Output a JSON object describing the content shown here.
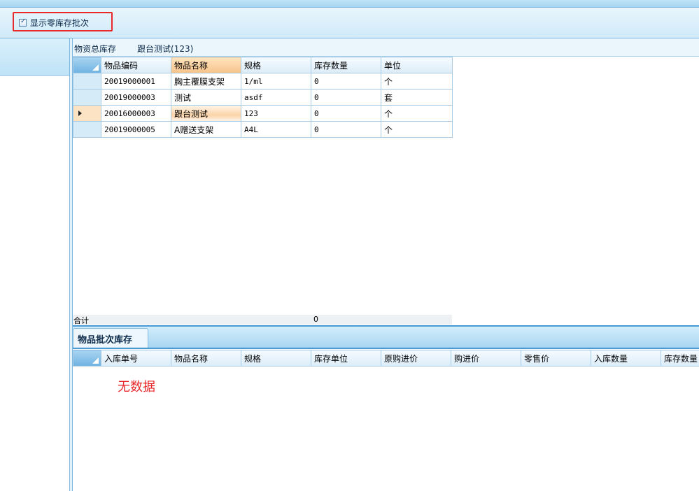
{
  "toolbar": {
    "show_zero_stock_batches": {
      "label": "显示零库存批次",
      "checked": true
    }
  },
  "info_bar": {
    "left_text": "物资总库存",
    "right_text": "跟台测试(123)"
  },
  "inventory_grid": {
    "columns": [
      "物品编码",
      "物品名称",
      "规格",
      "库存数量",
      "单位"
    ],
    "rows": [
      {
        "code": "20019000001",
        "name": "胸主覆膜支架",
        "spec": "1/ml",
        "qty": "0",
        "unit": "个"
      },
      {
        "code": "20019000003",
        "name": "测试",
        "spec": "asdf",
        "qty": "0",
        "unit": "套"
      },
      {
        "code": "20016000003",
        "name": "跟台测试",
        "spec": "123",
        "qty": "0",
        "unit": "个"
      },
      {
        "code": "20019000005",
        "name": "A赠送支架",
        "spec": "A4L",
        "qty": "0",
        "unit": "个"
      }
    ],
    "total_label": "合计",
    "total_qty": "0"
  },
  "batch_tab": {
    "label": "物品批次库存"
  },
  "batch_grid": {
    "columns": [
      "入库单号",
      "物品名称",
      "规格",
      "库存单位",
      "原购进价",
      "购进价",
      "零售价",
      "入库数量",
      "库存数量"
    ],
    "empty_text": "无数据"
  },
  "colors": {
    "highlight_border": "#e8282b",
    "empty_text": "#e8282b",
    "accent_blue": "#4a9ad3",
    "selected_header": "#f6c38a"
  }
}
